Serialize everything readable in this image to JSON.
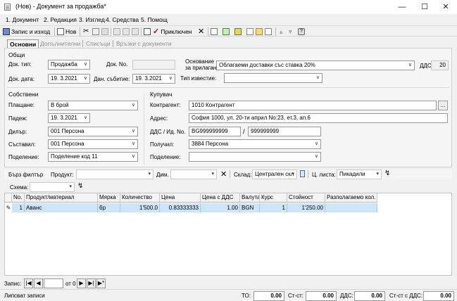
{
  "window": {
    "title": "(Нов) - Документ за продажба*"
  },
  "menu": [
    "1. Документ",
    "2. Редакция",
    "3. Изглед",
    "4. Средства",
    "5. Помощ"
  ],
  "toolbar": {
    "save_exit": "Запис и изход",
    "new": "Нов",
    "posted": "Приключен"
  },
  "tabs": [
    "Основни",
    "Допълнителни",
    "Списъци",
    "Връзки с документи"
  ],
  "general": {
    "section_title": "Общи",
    "doc_type_label": "Док. тип:",
    "doc_type_value": "Продажба",
    "doc_no_label": "Док. No.",
    "doc_no_value": "",
    "doc_date_label": "Док. дата:",
    "doc_date_value": "19.  3.2021",
    "tax_event_label": "Дан. събитие:",
    "tax_event_value": "19.  3.2021",
    "basis_label_1": "Основание",
    "basis_label_2": "за прилагане:",
    "basis_value": "Облагаеми доставки със ставка 20%",
    "vat_label": "ДДС:",
    "vat_value": "20",
    "notice_label": "Тип известие:",
    "notice_value": ""
  },
  "own": {
    "section_title": "Собствени",
    "payment_label": "Плащане:",
    "payment_value": "В брой",
    "due_label": "Падеж:",
    "due_value": "19.  3.2021",
    "dealer_label": "Дилър:",
    "dealer_value": "001 Персона",
    "composer_label": "Съставил:",
    "composer_value": "001 Персона",
    "division_label": "Поделение:",
    "division_value": "Поделение код 11"
  },
  "buyer": {
    "section_title": "Купувач",
    "contragent_label": "Контрагент:",
    "contragent_value": "1010 Контрагент",
    "address_label": "Адрес:",
    "address_value": "София 1000, ул. 20-ти април No:23, ет.3, ап.6",
    "vat_id_label": "ДДС / Ид. No.",
    "vat_no_value": "BG999999999",
    "id_no_value": "999999999",
    "receiver_label": "Получил:",
    "receiver_value": "3884 Персона",
    "division_label": "Поделение:",
    "division_value": "",
    "more_button": "..."
  },
  "filter": {
    "quick_filter_label": "Бърз филтър",
    "product_label": "Продукт:",
    "dim_label": "Дим.",
    "warehouse_label": "Склад:",
    "warehouse_value": "Централен скл",
    "pricelist_label": "Ц. листа:",
    "pricelist_value": "Пикадили",
    "schema_label": "Схема:"
  },
  "grid": {
    "columns": [
      "No.",
      "Продукт/материал",
      "Мярка",
      "Количество",
      "Цена",
      "Цена с ДДС",
      "Валута",
      "Курс",
      "Стойност",
      "Разполагаемо кол."
    ],
    "rows": [
      {
        "no": "1",
        "product": "Аванс",
        "unit": "бр",
        "qty": "1'500.0",
        "price": "0.83333333",
        "price_vat": "1.00",
        "currency": "BGN",
        "rate": "1",
        "value": "1'250.00",
        "available": ""
      }
    ]
  },
  "nav": {
    "record_label": "Запис:",
    "record_value": "",
    "of_label": "от 0"
  },
  "status": {
    "text": "Липсват записи",
    "to_label": "ТО:",
    "to_value": "0.00",
    "st_label": "Ст-ст:",
    "st_value": "0.00",
    "vat_label": "ДДС:",
    "vat_value": "0.00",
    "st_vat_label": "Ст-ст с ДДС:",
    "st_vat_value": "0.00"
  }
}
